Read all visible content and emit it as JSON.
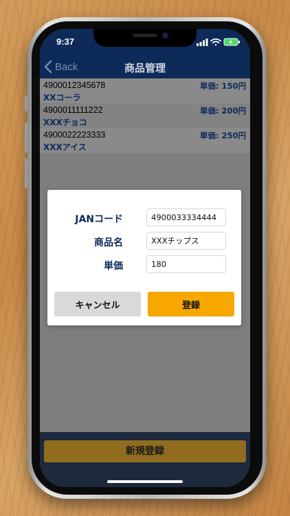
{
  "status_bar": {
    "time": "9:37"
  },
  "nav": {
    "back_label": "Back",
    "title": "商品管理"
  },
  "products": [
    {
      "jan": "4900012345678",
      "name": "XXコーラ",
      "price": "単価: 150円"
    },
    {
      "jan": "4900011111222",
      "name": "XXXチョコ",
      "price": "単価: 200円"
    },
    {
      "jan": "4900022223333",
      "name": "XXXアイス",
      "price": "単価: 250円"
    }
  ],
  "dialog": {
    "jan_label": "JANコード",
    "jan_value": "4900033334444",
    "name_label": "商品名",
    "name_value": "XXXチップス",
    "price_label": "単価",
    "price_value": "180",
    "cancel_label": "キャンセル",
    "register_label": "登録"
  },
  "footer": {
    "new_register_label": "新規登録"
  },
  "colors": {
    "navy": "#0d2a58",
    "accent_orange": "#f7a800",
    "label_navy": "#0c2a5c",
    "dimmed_button": "#8f6c1e"
  },
  "icons": [
    "back-chevron-icon",
    "signal-icon",
    "wifi-icon",
    "battery-charging-icon"
  ]
}
